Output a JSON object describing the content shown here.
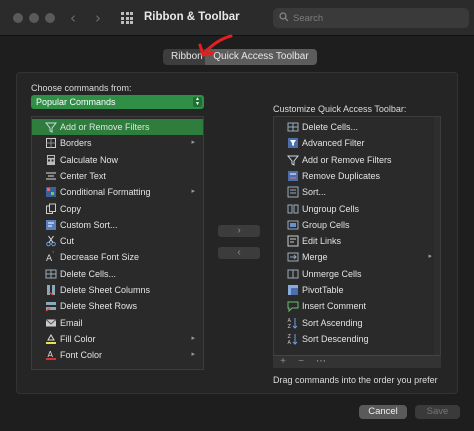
{
  "window": {
    "title": "Ribbon & Toolbar"
  },
  "search": {
    "placeholder": "Search"
  },
  "tabs": [
    {
      "label": "Ribbon",
      "active": false
    },
    {
      "label": "Quick Access Toolbar",
      "active": true
    }
  ],
  "left_panel": {
    "label": "Choose commands from:",
    "dropdown_value": "Popular Commands",
    "items": [
      {
        "label": "Add or Remove Filters",
        "icon": "filter-icon",
        "submenu": false,
        "selected": true
      },
      {
        "label": "Borders",
        "icon": "borders-icon",
        "submenu": true,
        "selected": false
      },
      {
        "label": "Calculate Now",
        "icon": "calculator-icon",
        "submenu": false,
        "selected": false
      },
      {
        "label": "Center Text",
        "icon": "center-text-icon",
        "submenu": false,
        "selected": false
      },
      {
        "label": "Conditional Formatting",
        "icon": "conditional-formatting-icon",
        "submenu": true,
        "selected": false
      },
      {
        "label": "Copy",
        "icon": "copy-icon",
        "submenu": false,
        "selected": false
      },
      {
        "label": "Custom Sort...",
        "icon": "custom-sort-icon",
        "submenu": false,
        "selected": false
      },
      {
        "label": "Cut",
        "icon": "scissors-icon",
        "submenu": false,
        "selected": false
      },
      {
        "label": "Decrease Font Size",
        "icon": "decrease-font-icon",
        "submenu": false,
        "selected": false
      },
      {
        "label": "Delete Cells...",
        "icon": "delete-cells-icon",
        "submenu": false,
        "selected": false
      },
      {
        "label": "Delete Sheet Columns",
        "icon": "delete-columns-icon",
        "submenu": false,
        "selected": false
      },
      {
        "label": "Delete Sheet Rows",
        "icon": "delete-rows-icon",
        "submenu": false,
        "selected": false
      },
      {
        "label": "Email",
        "icon": "email-icon",
        "submenu": false,
        "selected": false
      },
      {
        "label": "Fill Color",
        "icon": "fill-color-icon",
        "submenu": true,
        "selected": false
      },
      {
        "label": "Font Color",
        "icon": "font-color-icon",
        "submenu": true,
        "selected": false
      }
    ]
  },
  "right_panel": {
    "label": "Customize Quick Access Toolbar:",
    "items": [
      {
        "label": "Delete Cells...",
        "icon": "delete-cells-icon",
        "submenu": false
      },
      {
        "label": "Advanced Filter",
        "icon": "advanced-filter-icon",
        "submenu": false
      },
      {
        "label": "Add or Remove Filters",
        "icon": "filter-icon",
        "submenu": false
      },
      {
        "label": "Remove Duplicates",
        "icon": "remove-duplicates-icon",
        "submenu": false
      },
      {
        "label": "Sort...",
        "icon": "sort-icon",
        "submenu": false
      },
      {
        "label": "Ungroup Cells",
        "icon": "ungroup-icon",
        "submenu": false
      },
      {
        "label": "Group Cells",
        "icon": "group-icon",
        "submenu": false
      },
      {
        "label": "Edit Links",
        "icon": "edit-links-icon",
        "submenu": false
      },
      {
        "label": "Merge",
        "icon": "merge-icon",
        "submenu": true
      },
      {
        "label": "Unmerge Cells",
        "icon": "unmerge-icon",
        "submenu": false
      },
      {
        "label": "PivotTable",
        "icon": "pivottable-icon",
        "submenu": false
      },
      {
        "label": "Insert Comment",
        "icon": "insert-comment-icon",
        "submenu": false
      },
      {
        "label": "Sort Ascending",
        "icon": "sort-ascending-icon",
        "submenu": false
      },
      {
        "label": "Sort Descending",
        "icon": "sort-descending-icon",
        "submenu": false
      }
    ],
    "toolbar": {
      "add": "+",
      "remove": "−",
      "more": "⋯"
    },
    "hint": "Drag commands into the order you prefer"
  },
  "move_buttons": {
    "add": "›",
    "remove": "‹"
  },
  "footer": {
    "cancel": "Cancel",
    "save": "Save"
  },
  "colors": {
    "accent_green": "#2e7d3c",
    "annotation_red": "#e02020"
  }
}
